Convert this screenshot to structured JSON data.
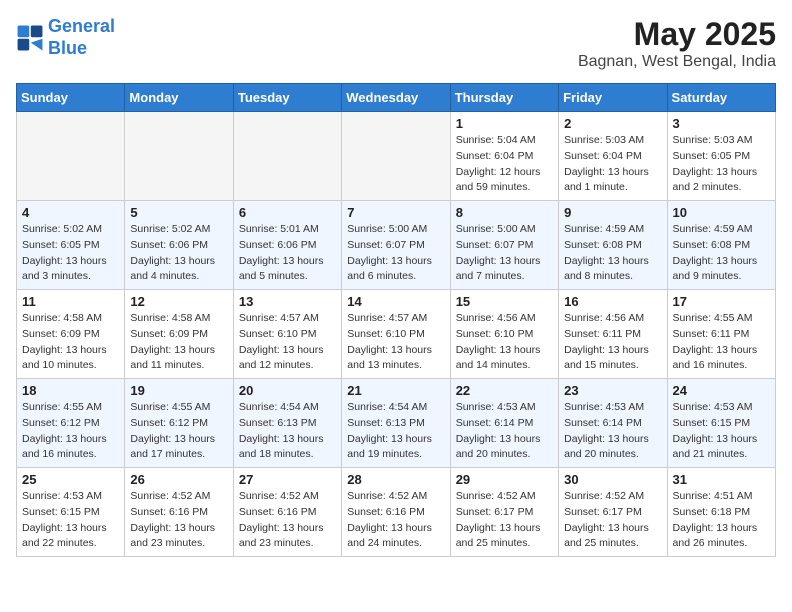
{
  "logo": {
    "line1": "General",
    "line2": "Blue"
  },
  "title": "May 2025",
  "subtitle": "Bagnan, West Bengal, India",
  "days_of_week": [
    "Sunday",
    "Monday",
    "Tuesday",
    "Wednesday",
    "Thursday",
    "Friday",
    "Saturday"
  ],
  "weeks": [
    [
      {
        "day": "",
        "info": ""
      },
      {
        "day": "",
        "info": ""
      },
      {
        "day": "",
        "info": ""
      },
      {
        "day": "",
        "info": ""
      },
      {
        "day": "1",
        "info": "Sunrise: 5:04 AM\nSunset: 6:04 PM\nDaylight: 12 hours and 59 minutes."
      },
      {
        "day": "2",
        "info": "Sunrise: 5:03 AM\nSunset: 6:04 PM\nDaylight: 13 hours and 1 minute."
      },
      {
        "day": "3",
        "info": "Sunrise: 5:03 AM\nSunset: 6:05 PM\nDaylight: 13 hours and 2 minutes."
      }
    ],
    [
      {
        "day": "4",
        "info": "Sunrise: 5:02 AM\nSunset: 6:05 PM\nDaylight: 13 hours and 3 minutes."
      },
      {
        "day": "5",
        "info": "Sunrise: 5:02 AM\nSunset: 6:06 PM\nDaylight: 13 hours and 4 minutes."
      },
      {
        "day": "6",
        "info": "Sunrise: 5:01 AM\nSunset: 6:06 PM\nDaylight: 13 hours and 5 minutes."
      },
      {
        "day": "7",
        "info": "Sunrise: 5:00 AM\nSunset: 6:07 PM\nDaylight: 13 hours and 6 minutes."
      },
      {
        "day": "8",
        "info": "Sunrise: 5:00 AM\nSunset: 6:07 PM\nDaylight: 13 hours and 7 minutes."
      },
      {
        "day": "9",
        "info": "Sunrise: 4:59 AM\nSunset: 6:08 PM\nDaylight: 13 hours and 8 minutes."
      },
      {
        "day": "10",
        "info": "Sunrise: 4:59 AM\nSunset: 6:08 PM\nDaylight: 13 hours and 9 minutes."
      }
    ],
    [
      {
        "day": "11",
        "info": "Sunrise: 4:58 AM\nSunset: 6:09 PM\nDaylight: 13 hours and 10 minutes."
      },
      {
        "day": "12",
        "info": "Sunrise: 4:58 AM\nSunset: 6:09 PM\nDaylight: 13 hours and 11 minutes."
      },
      {
        "day": "13",
        "info": "Sunrise: 4:57 AM\nSunset: 6:10 PM\nDaylight: 13 hours and 12 minutes."
      },
      {
        "day": "14",
        "info": "Sunrise: 4:57 AM\nSunset: 6:10 PM\nDaylight: 13 hours and 13 minutes."
      },
      {
        "day": "15",
        "info": "Sunrise: 4:56 AM\nSunset: 6:10 PM\nDaylight: 13 hours and 14 minutes."
      },
      {
        "day": "16",
        "info": "Sunrise: 4:56 AM\nSunset: 6:11 PM\nDaylight: 13 hours and 15 minutes."
      },
      {
        "day": "17",
        "info": "Sunrise: 4:55 AM\nSunset: 6:11 PM\nDaylight: 13 hours and 16 minutes."
      }
    ],
    [
      {
        "day": "18",
        "info": "Sunrise: 4:55 AM\nSunset: 6:12 PM\nDaylight: 13 hours and 16 minutes."
      },
      {
        "day": "19",
        "info": "Sunrise: 4:55 AM\nSunset: 6:12 PM\nDaylight: 13 hours and 17 minutes."
      },
      {
        "day": "20",
        "info": "Sunrise: 4:54 AM\nSunset: 6:13 PM\nDaylight: 13 hours and 18 minutes."
      },
      {
        "day": "21",
        "info": "Sunrise: 4:54 AM\nSunset: 6:13 PM\nDaylight: 13 hours and 19 minutes."
      },
      {
        "day": "22",
        "info": "Sunrise: 4:53 AM\nSunset: 6:14 PM\nDaylight: 13 hours and 20 minutes."
      },
      {
        "day": "23",
        "info": "Sunrise: 4:53 AM\nSunset: 6:14 PM\nDaylight: 13 hours and 20 minutes."
      },
      {
        "day": "24",
        "info": "Sunrise: 4:53 AM\nSunset: 6:15 PM\nDaylight: 13 hours and 21 minutes."
      }
    ],
    [
      {
        "day": "25",
        "info": "Sunrise: 4:53 AM\nSunset: 6:15 PM\nDaylight: 13 hours and 22 minutes."
      },
      {
        "day": "26",
        "info": "Sunrise: 4:52 AM\nSunset: 6:16 PM\nDaylight: 13 hours and 23 minutes."
      },
      {
        "day": "27",
        "info": "Sunrise: 4:52 AM\nSunset: 6:16 PM\nDaylight: 13 hours and 23 minutes."
      },
      {
        "day": "28",
        "info": "Sunrise: 4:52 AM\nSunset: 6:16 PM\nDaylight: 13 hours and 24 minutes."
      },
      {
        "day": "29",
        "info": "Sunrise: 4:52 AM\nSunset: 6:17 PM\nDaylight: 13 hours and 25 minutes."
      },
      {
        "day": "30",
        "info": "Sunrise: 4:52 AM\nSunset: 6:17 PM\nDaylight: 13 hours and 25 minutes."
      },
      {
        "day": "31",
        "info": "Sunrise: 4:51 AM\nSunset: 6:18 PM\nDaylight: 13 hours and 26 minutes."
      }
    ]
  ]
}
